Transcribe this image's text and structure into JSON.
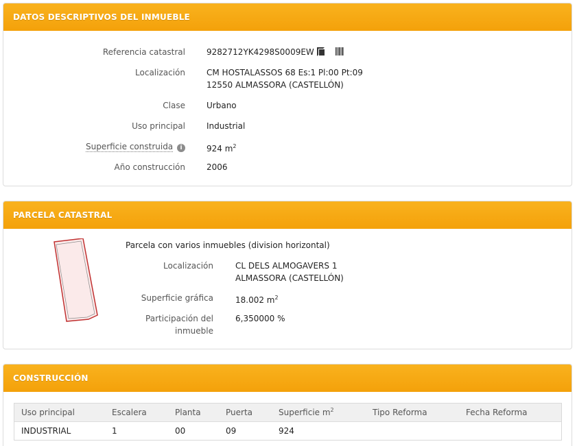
{
  "descriptivos": {
    "title": "DATOS DESCRIPTIVOS DEL INMUEBLE",
    "referencia_label": "Referencia catastral",
    "referencia_value": "9282712YK4298S0009EW",
    "localizacion_label": "Localización",
    "localizacion_line1": "CM HOSTALASSOS 68 Es:1 Pl:00 Pt:09",
    "localizacion_line2": "12550 ALMASSORA (CASTELLÓN)",
    "clase_label": "Clase",
    "clase_value": "Urbano",
    "uso_label": "Uso principal",
    "uso_value": "Industrial",
    "superficie_label": "Superficie construida",
    "superficie_value": "924 m",
    "superficie_sup": "2",
    "anio_label": "Año construcción",
    "anio_value": "2006"
  },
  "parcela": {
    "title": "PARCELA CATASTRAL",
    "description": "Parcela con varios inmuebles (division horizontal)",
    "localizacion_label": "Localización",
    "localizacion_line1": "CL DELS ALMOGAVERS 1",
    "localizacion_line2": "ALMASSORA (CASTELLÓN)",
    "superficie_label": "Superficie gráfica",
    "superficie_value": "18.002 m",
    "superficie_sup": "2",
    "participacion_label_line1": "Participación del",
    "participacion_label_line2": "inmueble",
    "participacion_value": "6,350000 %"
  },
  "construccion": {
    "title": "CONSTRUCCIÓN",
    "columns": {
      "uso": "Uso principal",
      "escalera": "Escalera",
      "planta": "Planta",
      "puerta": "Puerta",
      "superficie": "Superficie m",
      "superficie_sup": "2",
      "tipo_reforma": "Tipo Reforma",
      "fecha_reforma": "Fecha Reforma"
    },
    "rows": [
      {
        "uso": "INDUSTRIAL",
        "escalera": "1",
        "planta": "00",
        "puerta": "09",
        "superficie": "924",
        "tipo_reforma": "",
        "fecha_reforma": ""
      }
    ]
  },
  "icons": {
    "copy": "copy-icon",
    "barcode": "barcode-icon",
    "info": "info-icon"
  },
  "colors": {
    "header": "#f4a10a",
    "parcel_fill": "#fbeaea",
    "parcel_outline": "#c03030"
  }
}
